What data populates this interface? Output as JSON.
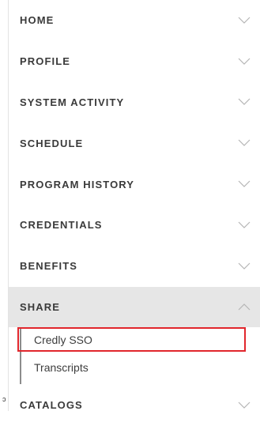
{
  "nav": {
    "items": [
      {
        "label": "HOME",
        "state": "collapsed"
      },
      {
        "label": "PROFILE",
        "state": "collapsed"
      },
      {
        "label": "SYSTEM ACTIVITY",
        "state": "collapsed"
      },
      {
        "label": "SCHEDULE",
        "state": "collapsed"
      },
      {
        "label": "PROGRAM HISTORY",
        "state": "collapsed"
      },
      {
        "label": "CREDENTIALS",
        "state": "collapsed"
      },
      {
        "label": "BENEFITS",
        "state": "collapsed"
      },
      {
        "label": "SHARE",
        "state": "expanded"
      }
    ],
    "share_submenu": [
      {
        "label": "Credly SSO",
        "highlighted": true
      },
      {
        "label": "Transcripts",
        "highlighted": false
      }
    ],
    "last_item": {
      "label": "CATALOGS",
      "state": "collapsed"
    }
  },
  "icons": {
    "collapsed": "chevron-down-icon",
    "expanded": "chevron-up-icon"
  },
  "colors": {
    "highlight_border": "#e1262c",
    "active_background": "#e6e6e6",
    "label_text": "#3a3a3a"
  }
}
